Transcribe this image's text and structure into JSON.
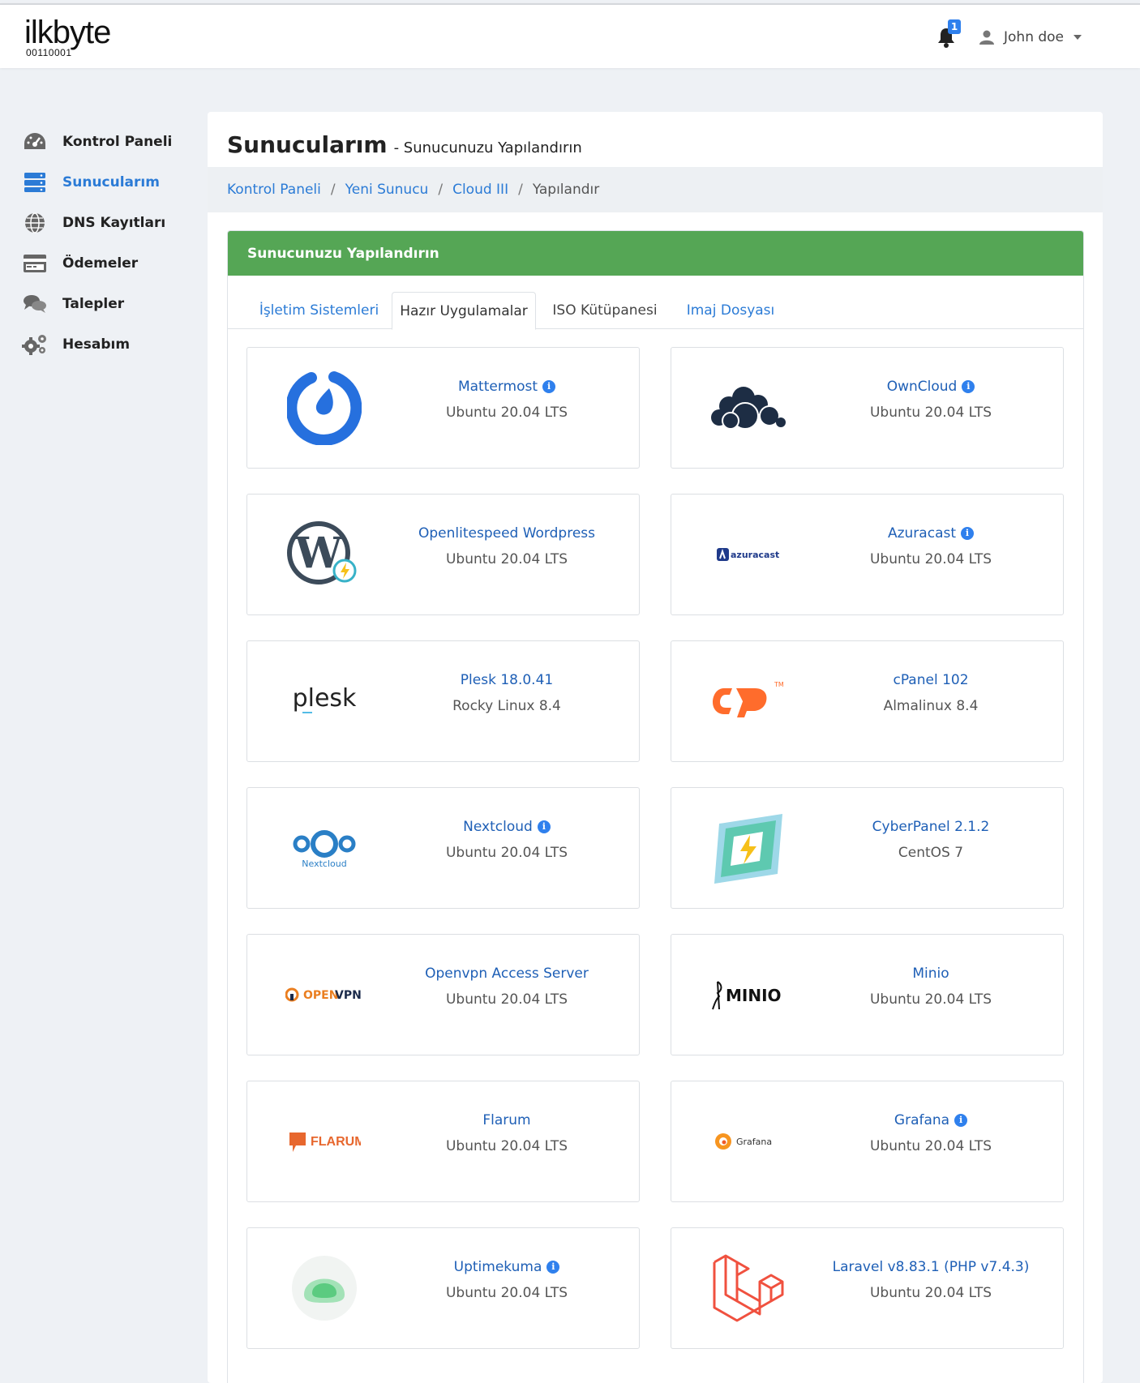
{
  "brand": {
    "logo": "ilkbyte",
    "logo_sub": "00110001"
  },
  "header": {
    "notifications_count": "1",
    "user_name": "John doe"
  },
  "sidebar": {
    "items": [
      {
        "label": "Kontrol Paneli",
        "icon": "dashboard-gauge-icon"
      },
      {
        "label": "Sunucularım",
        "icon": "server-icon"
      },
      {
        "label": "DNS Kayıtları",
        "icon": "globe-icon"
      },
      {
        "label": "Ödemeler",
        "icon": "credit-card-icon"
      },
      {
        "label": "Talepler",
        "icon": "comments-icon"
      },
      {
        "label": "Hesabım",
        "icon": "cogs-icon"
      }
    ]
  },
  "page": {
    "title": "Sunucularım",
    "subtitle": "- Sunucunuzu Yapılandırın"
  },
  "breadcrumb": {
    "items": [
      "Kontrol Paneli",
      "Yeni Sunucu",
      "Cloud III",
      "Yapılandır"
    ]
  },
  "card": {
    "title": "Sunucunuzu Yapılandırın"
  },
  "tabs": [
    "İşletim Sistemleri",
    "Hazır Uygulamalar",
    "ISO Kütüpanesi",
    "Imaj Dosyası"
  ],
  "logo_texts": {
    "azuracast": "azuracast",
    "plesk": "plesk",
    "nextcloud": "Nextcloud",
    "openvpn_a": "OPEN",
    "openvpn_b": "VPN",
    "minio": "MINIO",
    "flarum": "FLARUM",
    "grafana": "Grafana",
    "cpanel_tm": "TM"
  },
  "apps": [
    {
      "name": "Mattermost",
      "os": "Ubuntu 20.04 LTS",
      "info": true
    },
    {
      "name": "OwnCloud",
      "os": "Ubuntu 20.04 LTS",
      "info": true
    },
    {
      "name": "Openlitespeed Wordpress",
      "os": "Ubuntu 20.04 LTS",
      "info": false
    },
    {
      "name": "Azuracast",
      "os": "Ubuntu 20.04 LTS",
      "info": true
    },
    {
      "name": "Plesk 18.0.41",
      "os": "Rocky Linux 8.4",
      "info": false
    },
    {
      "name": "cPanel 102",
      "os": "Almalinux 8.4",
      "info": false
    },
    {
      "name": "Nextcloud",
      "os": "Ubuntu 20.04 LTS",
      "info": true
    },
    {
      "name": "CyberPanel 2.1.2",
      "os": "CentOS 7",
      "info": false
    },
    {
      "name": "Openvpn Access Server",
      "os": "Ubuntu 20.04 LTS",
      "info": false
    },
    {
      "name": "Minio",
      "os": "Ubuntu 20.04 LTS",
      "info": false
    },
    {
      "name": "Flarum",
      "os": "Ubuntu 20.04 LTS",
      "info": false
    },
    {
      "name": "Grafana",
      "os": "Ubuntu 20.04 LTS",
      "info": true
    },
    {
      "name": "Uptimekuma",
      "os": "Ubuntu 20.04 LTS",
      "info": true
    },
    {
      "name": "Laravel v8.83.1 (PHP v7.4.3)",
      "os": "Ubuntu 20.04 LTS",
      "info": false
    }
  ],
  "info_glyph": "i",
  "colors": {
    "accent": "#2b7bd6",
    "card_header": "#55a655",
    "link": "#1e5fb6"
  }
}
